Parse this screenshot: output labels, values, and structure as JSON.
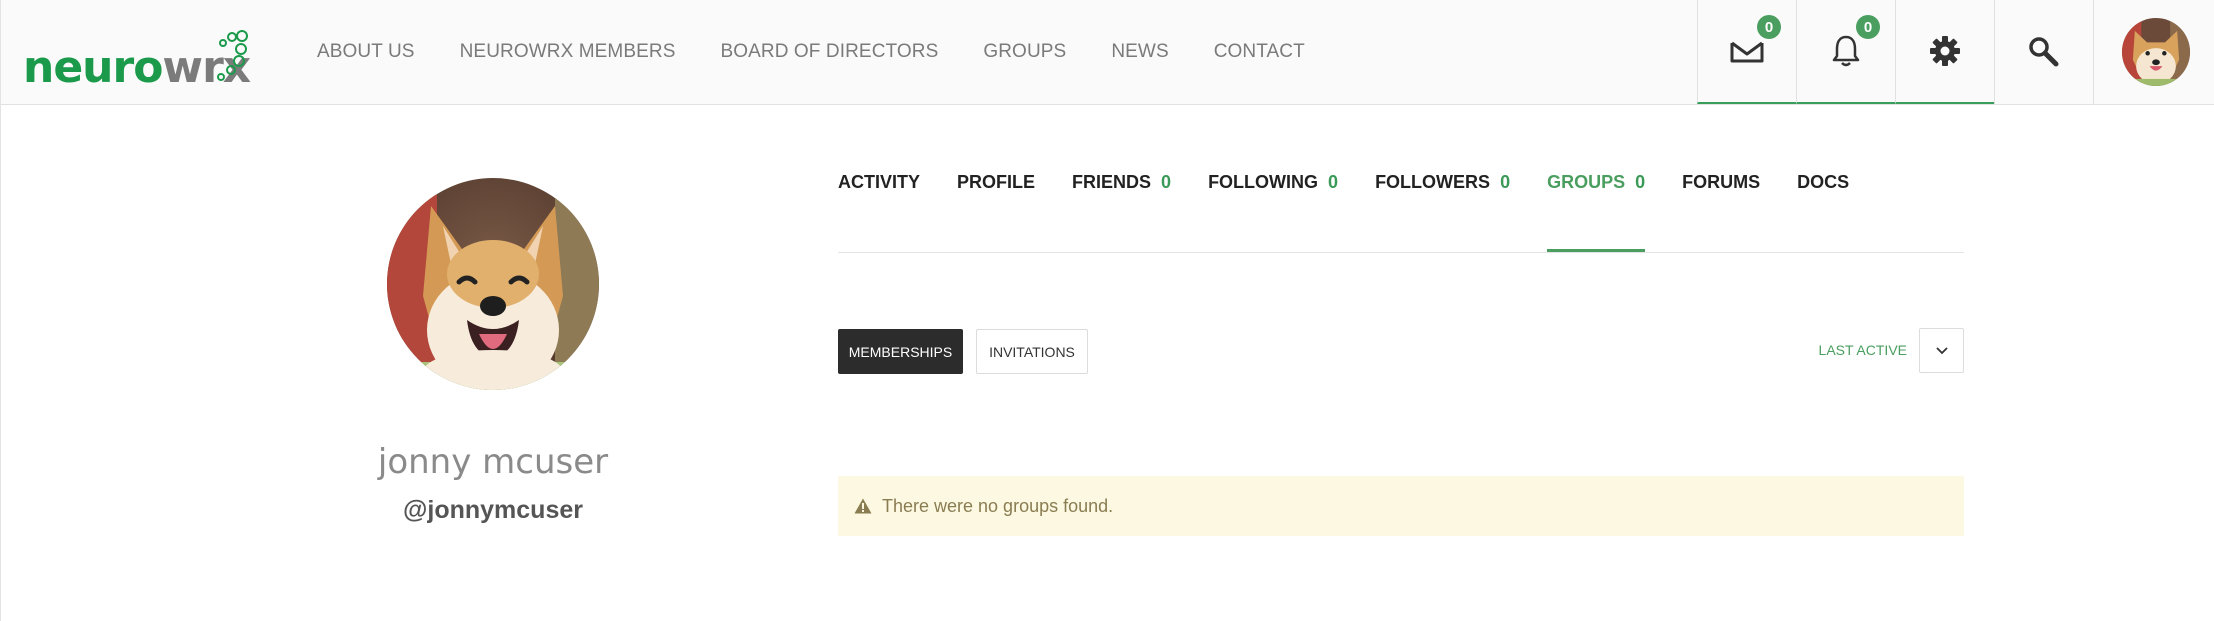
{
  "brand": {
    "logo_part1": "neuro",
    "logo_part2": "wrx"
  },
  "main_nav": [
    "ABOUT US",
    "NEUROWRX MEMBERS",
    "BOARD OF DIRECTORS",
    "GROUPS",
    "NEWS",
    "CONTACT"
  ],
  "header_icons": {
    "messages_count": "0",
    "notifications_count": "0"
  },
  "profile": {
    "name": "jonny mcuser",
    "handle": "@jonnymcuser"
  },
  "profile_tabs": [
    {
      "label": "ACTIVITY",
      "count": ""
    },
    {
      "label": "PROFILE",
      "count": ""
    },
    {
      "label": "FRIENDS",
      "count": "0"
    },
    {
      "label": "FOLLOWING",
      "count": "0"
    },
    {
      "label": "FOLLOWERS",
      "count": "0"
    },
    {
      "label": "GROUPS",
      "count": "0"
    },
    {
      "label": "FORUMS",
      "count": ""
    },
    {
      "label": "DOCS",
      "count": ""
    }
  ],
  "groups_filters": {
    "memberships_label": "MEMBERSHIPS",
    "invitations_label": "INVITATIONS",
    "sort_label": "LAST ACTIVE"
  },
  "notice": {
    "text": "There were no groups found."
  },
  "colors": {
    "brand_green": "#1b9a4b",
    "accent_green": "#4a9e5f",
    "notice_bg": "#fcf8e1",
    "dark_button": "#2c2c2c"
  }
}
